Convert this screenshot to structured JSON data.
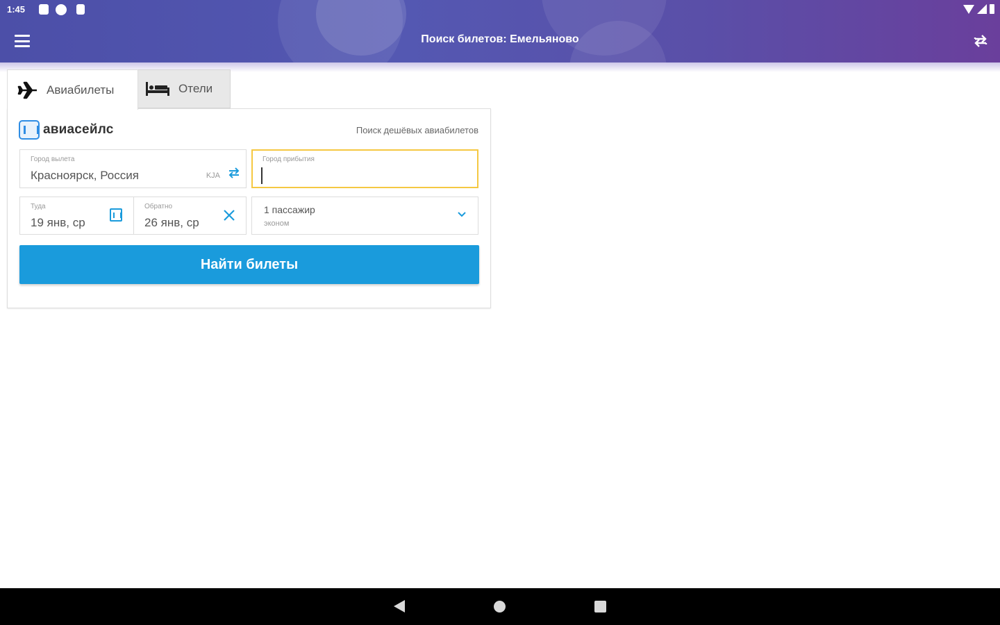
{
  "status_bar": {
    "time": "1:45"
  },
  "app_bar": {
    "title": "Поиск билетов: Емельяново"
  },
  "tabs": [
    {
      "label": "Авиабилеты",
      "icon": "airplane-icon",
      "active": true
    },
    {
      "label": "Отели",
      "icon": "bed-icon",
      "active": false
    }
  ],
  "search_form": {
    "brand_name": "авиасейлс",
    "tagline": "Поиск дешёвых авиабилетов",
    "origin": {
      "label": "Город вылета",
      "value": "Красноярск, Россия",
      "iata": "KJA"
    },
    "destination": {
      "label": "Город прибытия",
      "value": ""
    },
    "depart": {
      "label": "Туда",
      "value": "19 янв, ср"
    },
    "return": {
      "label": "Обратно",
      "value": "26 янв, ср"
    },
    "passengers": {
      "main": "1 пассажир",
      "class": "эконом"
    },
    "search_button": "Найти билеты"
  },
  "colors": {
    "header_gradient_start": "#4c4fa8",
    "header_gradient_end": "#6a3f9c",
    "primary_button": "#1a9bdc",
    "focus_border": "#f5c842"
  }
}
